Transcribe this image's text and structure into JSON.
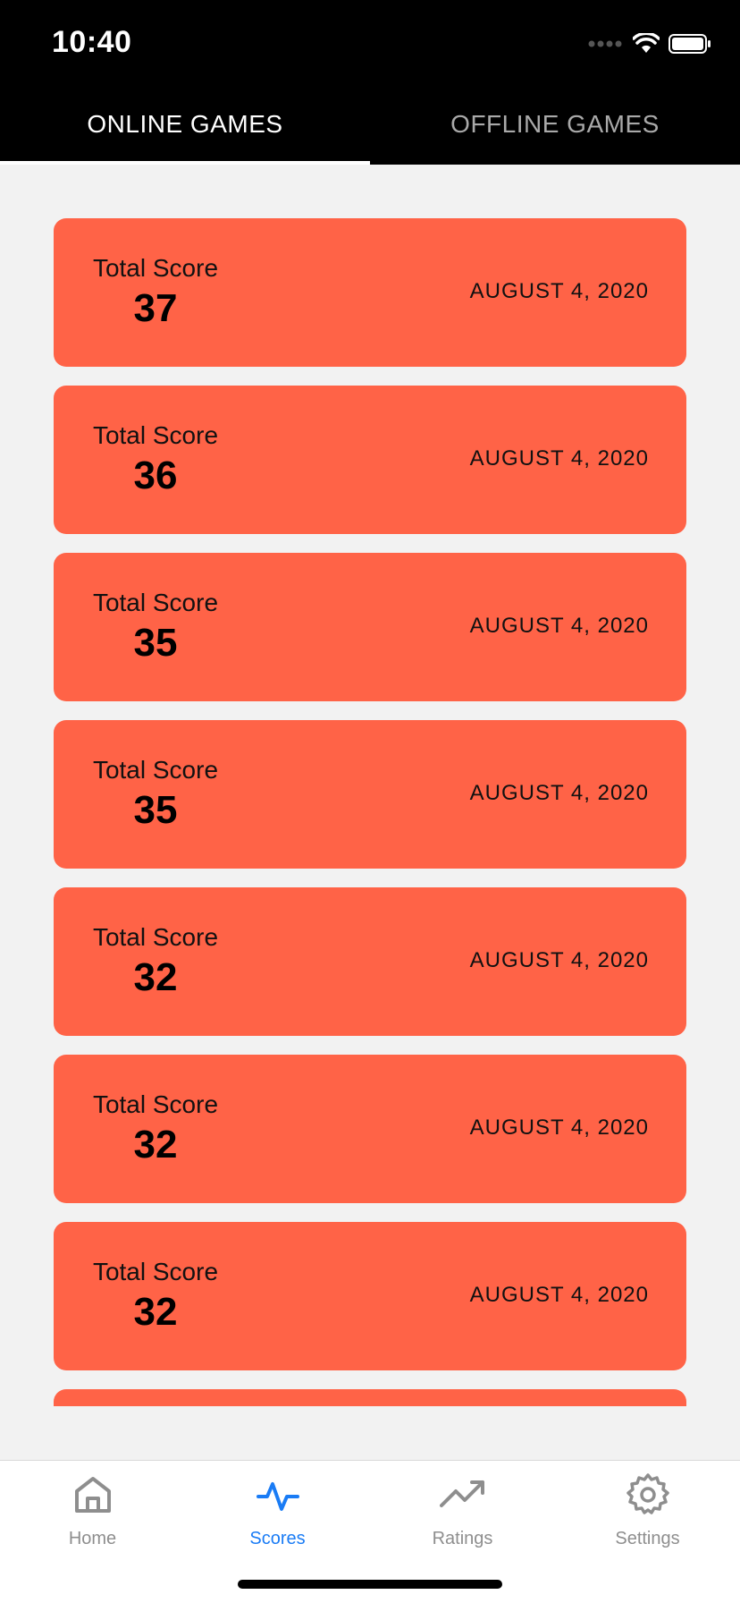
{
  "status_bar": {
    "time": "10:40"
  },
  "top_tabs": [
    {
      "label": "ONLINE GAMES",
      "active": true
    },
    {
      "label": "OFFLINE GAMES",
      "active": false
    }
  ],
  "scores": [
    {
      "label": "Total Score",
      "value": "37",
      "date": "AUGUST 4, 2020"
    },
    {
      "label": "Total Score",
      "value": "36",
      "date": "AUGUST 4, 2020"
    },
    {
      "label": "Total Score",
      "value": "35",
      "date": "AUGUST 4, 2020"
    },
    {
      "label": "Total Score",
      "value": "35",
      "date": "AUGUST 4, 2020"
    },
    {
      "label": "Total Score",
      "value": "32",
      "date": "AUGUST 4, 2020"
    },
    {
      "label": "Total Score",
      "value": "32",
      "date": "AUGUST 4, 2020"
    },
    {
      "label": "Total Score",
      "value": "32",
      "date": "AUGUST 4, 2020"
    }
  ],
  "bottom_nav": [
    {
      "label": "Home",
      "icon": "home-icon",
      "active": false
    },
    {
      "label": "Scores",
      "icon": "activity-icon",
      "active": true
    },
    {
      "label": "Ratings",
      "icon": "trending-up-icon",
      "active": false
    },
    {
      "label": "Settings",
      "icon": "gear-icon",
      "active": false
    }
  ],
  "colors": {
    "card": "#ff6347",
    "accent": "#1a7cf5",
    "inactive": "#8e8e8e",
    "header": "#000000"
  }
}
